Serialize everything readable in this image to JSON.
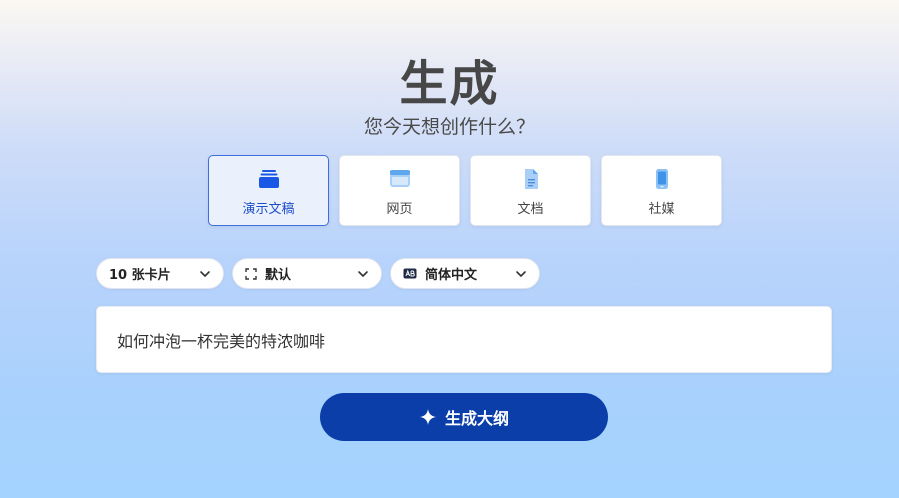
{
  "header": {
    "title": "生成",
    "subtitle": "您今天想创作什么？"
  },
  "content_types": [
    {
      "label": "演示文稿",
      "icon": "presentation-icon",
      "selected": true
    },
    {
      "label": "网页",
      "icon": "webpage-icon",
      "selected": false
    },
    {
      "label": "文档",
      "icon": "document-icon",
      "selected": false
    },
    {
      "label": "社媒",
      "icon": "social-media-icon",
      "selected": false
    }
  ],
  "options": {
    "card_count": "10 张卡片",
    "layout": "默认",
    "language": "简体中文"
  },
  "prompt": {
    "value": "如何冲泡一杯完美的特浓咖啡"
  },
  "generate_button": {
    "label": "生成大纲"
  },
  "colors": {
    "accent": "#0b3ea8",
    "selected_border": "#3f6fd8",
    "selected_bg": "#eaf1fd"
  }
}
